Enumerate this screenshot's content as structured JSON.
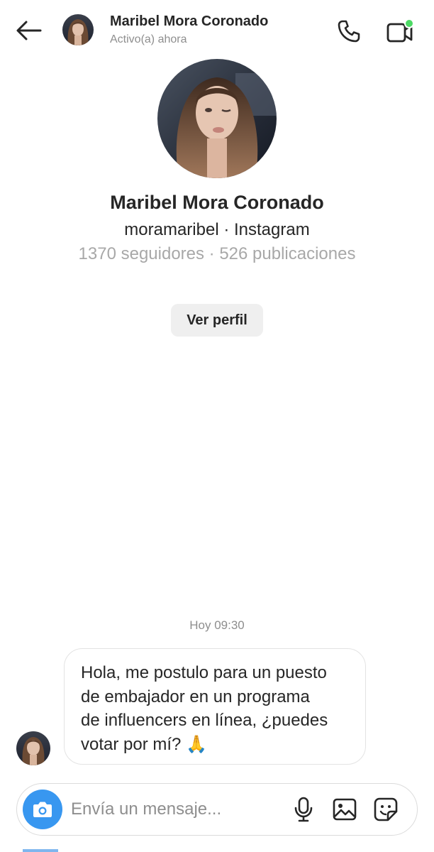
{
  "header": {
    "name": "Maribel Mora Coronado",
    "status": "Activo(a) ahora",
    "back_icon": "arrow-left-icon",
    "call_icon": "phone-icon",
    "video_icon": "video-camera-icon",
    "online_indicator_color": "#4cd964"
  },
  "profile": {
    "name": "Maribel Mora Coronado",
    "handle": "moramaribel · Instagram",
    "stats": "1370 seguidores · 526 publicaciones",
    "view_profile_label": "Ver perfil"
  },
  "conversation": {
    "timestamp": "Hoy 09:30",
    "messages": [
      {
        "text": "Hola, me postulo para un puesto\nde embajador en un programa\nde influencers en línea, ¿puedes\nvotar por mí? 🙏"
      }
    ]
  },
  "composer": {
    "placeholder": "Envía un mensaje...",
    "camera_icon": "camera-icon",
    "mic_icon": "microphone-icon",
    "gallery_icon": "image-icon",
    "sticker_icon": "sticker-icon",
    "accent_color": "#3897f0"
  }
}
